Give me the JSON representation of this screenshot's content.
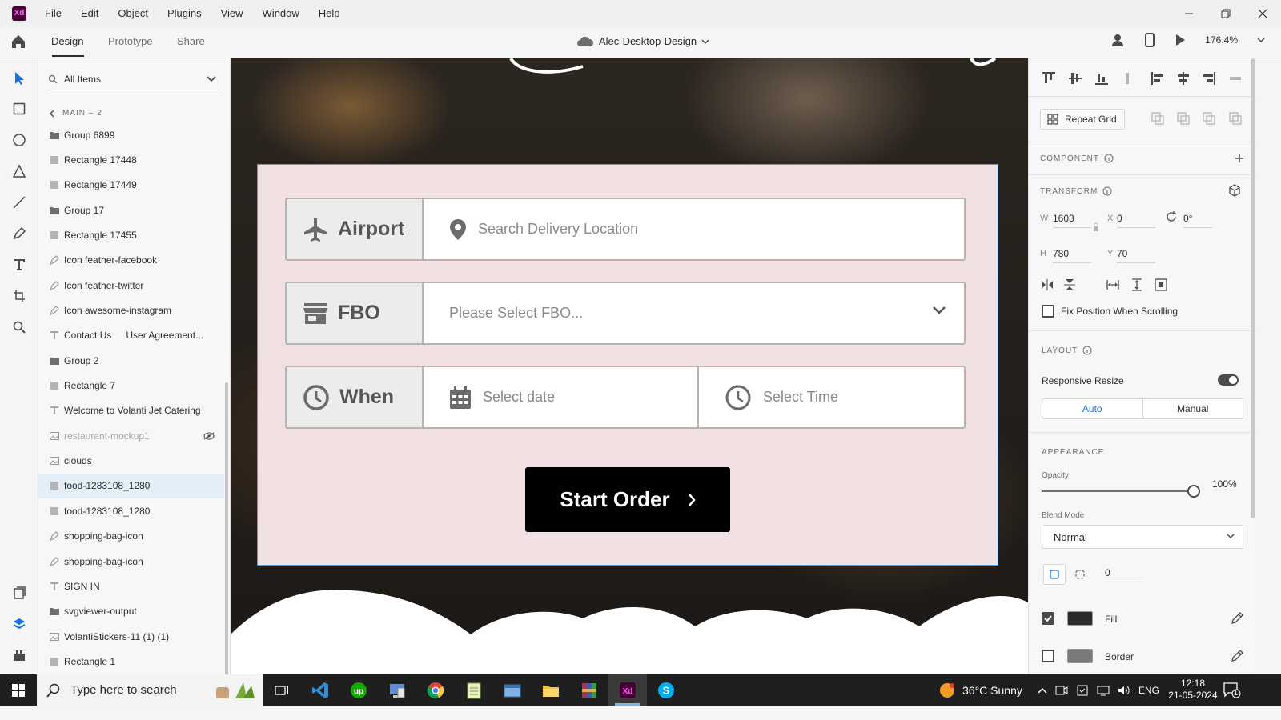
{
  "menu": [
    "File",
    "Edit",
    "Object",
    "Plugins",
    "View",
    "Window",
    "Help"
  ],
  "app_logo": "Xd",
  "toolbar": {
    "tabs": [
      "Design",
      "Prototype",
      "Share"
    ],
    "doc_title": "Alec-Desktop-Design",
    "zoom": "176.4%"
  },
  "layers": {
    "search_placeholder": "All Items",
    "breadcrumb": "MAIN – 2",
    "items": [
      {
        "label": "Group 6899",
        "type": "folder"
      },
      {
        "label": "Rectangle 17448",
        "type": "rect"
      },
      {
        "label": "Rectangle 17449",
        "type": "rect"
      },
      {
        "label": "Group 17",
        "type": "folder"
      },
      {
        "label": "Rectangle 17455",
        "type": "rect"
      },
      {
        "label": "Icon feather-facebook",
        "type": "path"
      },
      {
        "label": "Icon feather-twitter",
        "type": "path"
      },
      {
        "label": "Icon awesome-instagram",
        "type": "path"
      },
      {
        "label": "Contact Us",
        "extra": "User Agreement...",
        "type": "text"
      },
      {
        "label": "Group 2",
        "type": "folder"
      },
      {
        "label": "Rectangle 7",
        "type": "rect"
      },
      {
        "label": "Welcome to Volanti Jet Catering",
        "type": "text"
      },
      {
        "label": "restaurant-mockup1",
        "type": "image",
        "hidden": true
      },
      {
        "label": "clouds",
        "type": "image"
      },
      {
        "label": "food-1283108_1280",
        "type": "rect",
        "selected": true
      },
      {
        "label": "food-1283108_1280",
        "type": "rect"
      },
      {
        "label": "shopping-bag-icon",
        "type": "path"
      },
      {
        "label": "shopping-bag-icon",
        "type": "path"
      },
      {
        "label": "SIGN IN",
        "type": "text"
      },
      {
        "label": "svgviewer-output",
        "type": "folder"
      },
      {
        "label": "VolantiStickers-11 (1) (1)",
        "type": "image"
      },
      {
        "label": "Rectangle 1",
        "type": "rect"
      }
    ]
  },
  "form": {
    "airport_label": "Airport",
    "airport_placeholder": "Search Delivery Location",
    "fbo_label": "FBO",
    "fbo_placeholder": "Please Select FBO...",
    "when_label": "When",
    "date_placeholder": "Select date",
    "time_placeholder": "Select Time",
    "start_button": "Start Order"
  },
  "props": {
    "repeat_grid": "Repeat Grid",
    "component_title": "COMPONENT",
    "transform_title": "TRANSFORM",
    "w_label": "W",
    "w": "1603",
    "h_label": "H",
    "h": "780",
    "x_label": "X",
    "x": "0",
    "y_label": "Y",
    "y": "70",
    "rotation": "0°",
    "fix_position": "Fix Position When Scrolling",
    "layout_title": "LAYOUT",
    "responsive_resize": "Responsive Resize",
    "auto": "Auto",
    "manual": "Manual",
    "appearance_title": "APPEARANCE",
    "opacity_label": "Opacity",
    "opacity_value": "100%",
    "opacity": 1.0,
    "blend_label": "Blend Mode",
    "blend_value": "Normal",
    "corner_radius": "0",
    "fill_label": "Fill",
    "fill_color": "#2b2b2b",
    "border_label": "Border",
    "border_color": "#7a7a7a"
  },
  "taskbar": {
    "search_placeholder": "Type here to search",
    "weather": "36°C  Sunny",
    "lang": "ENG",
    "time": "12:18",
    "date": "21-05-2024",
    "notification_count": "1"
  },
  "colors": {
    "accent": "#1473e6",
    "xd_brand": "#470137",
    "xd_pink": "#ff61f6",
    "card_bg": "#f2e1e3"
  }
}
